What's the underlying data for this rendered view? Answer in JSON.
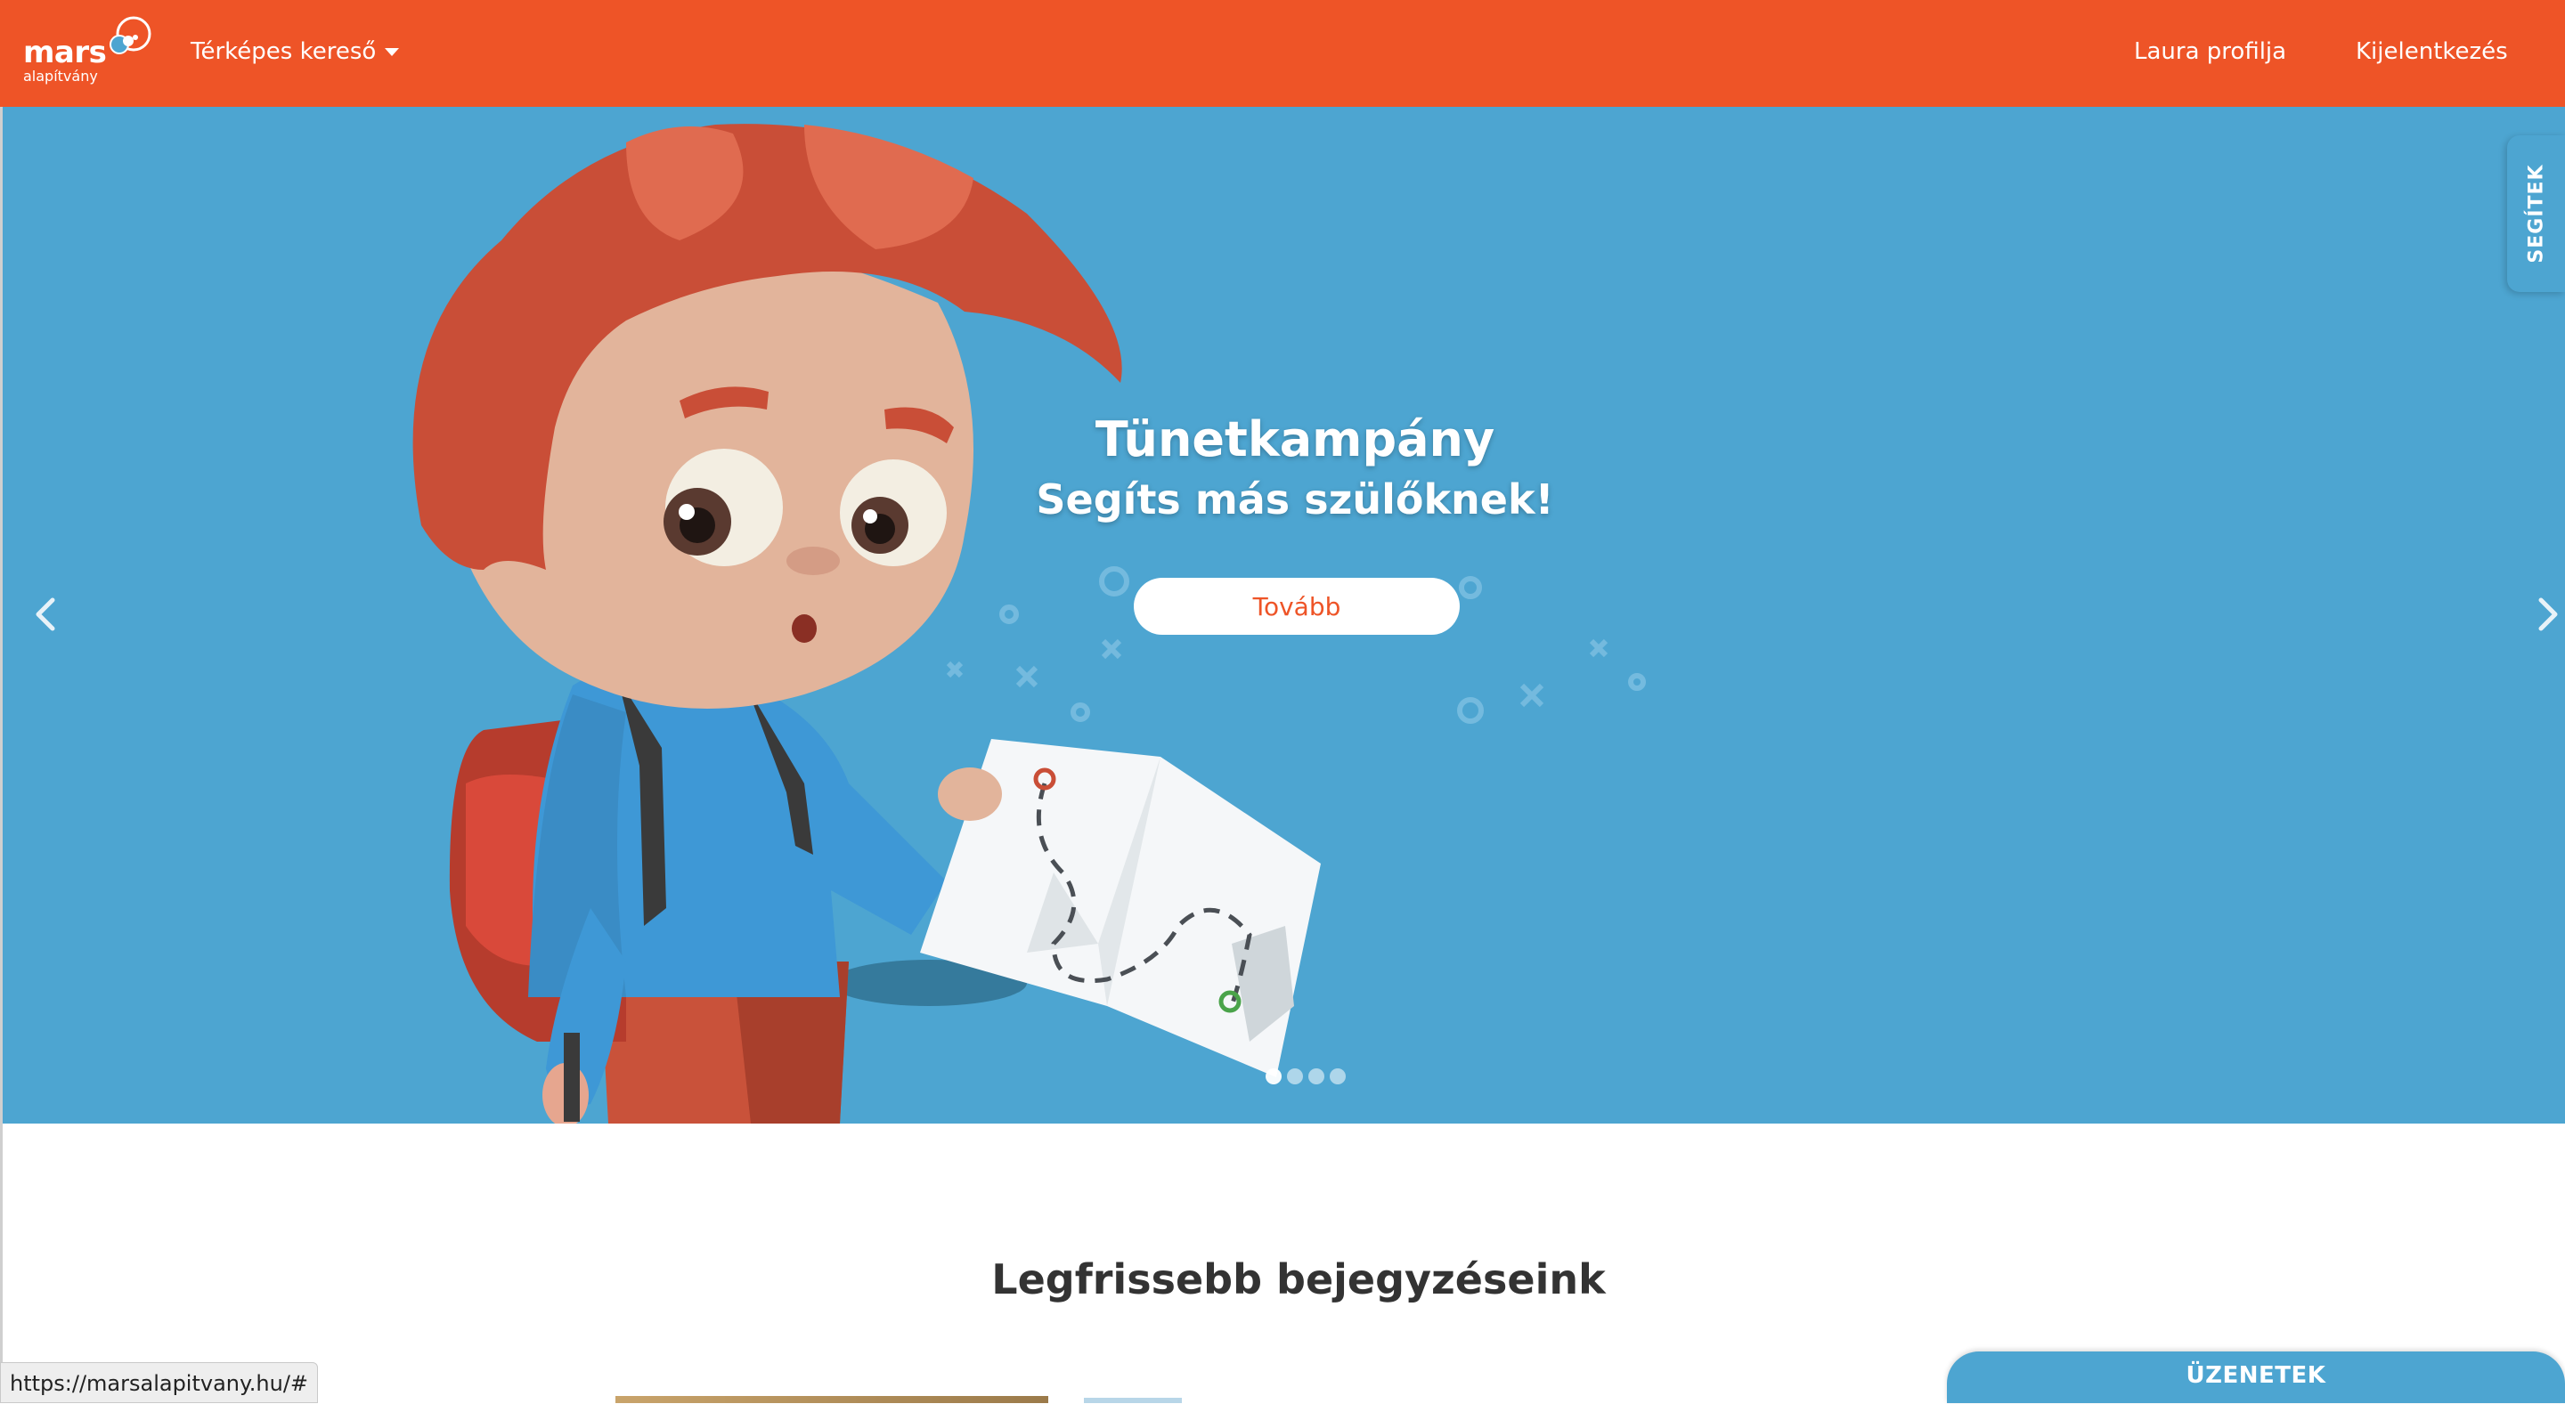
{
  "brand": {
    "name": "mars",
    "subtitle": "alapítvány",
    "color": "#ee5427"
  },
  "nav": {
    "map_search_label": "Térképes kereső",
    "profile_label": "Laura profilja",
    "logout_label": "Kijelentkezés"
  },
  "hero": {
    "background_color": "#4da5d1",
    "title": "Tünetkampány",
    "subtitle": "Segíts más szülőknek!",
    "button_label": "Tovább",
    "slides_count": 4,
    "active_slide": 1,
    "prev_icon": "chevron-left-icon",
    "next_icon": "chevron-right-icon"
  },
  "side_tab": {
    "label": "SEGÍTEK"
  },
  "main": {
    "section_title": "Legfrissebb bejegyzéseink"
  },
  "status_bar": {
    "url": "https://marsalapitvany.hu/#"
  },
  "messages": {
    "label": "ÜZENETEK"
  }
}
